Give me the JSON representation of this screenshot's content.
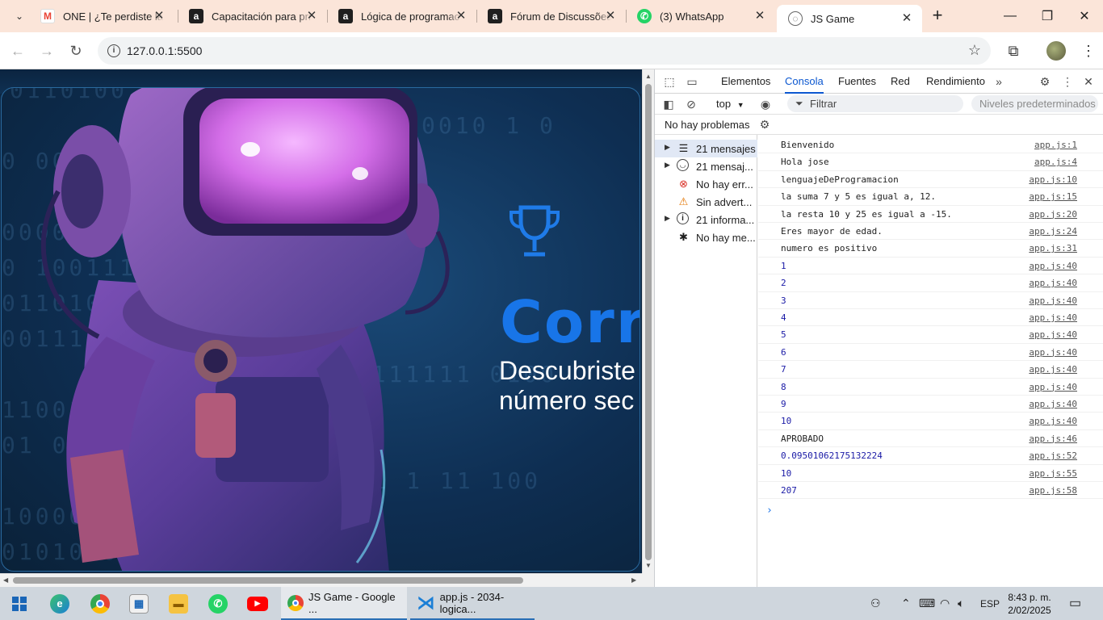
{
  "browser": {
    "tabs": [
      {
        "title": "ONE | ¿Te perdiste la",
        "icon": "gmail-icon"
      },
      {
        "title": "Capacitación para pri",
        "icon": "alura-icon"
      },
      {
        "title": "Lógica de programac",
        "icon": "alura-icon"
      },
      {
        "title": "Fórum de Discussões",
        "icon": "alura-icon"
      },
      {
        "title": "(3) WhatsApp",
        "icon": "whatsapp-icon"
      },
      {
        "title": "JS Game",
        "icon": "globe-icon",
        "active": true
      }
    ],
    "url": "127.0.0.1:5500"
  },
  "page": {
    "title_partial": "Corre",
    "subtitle_line1": "Descubriste",
    "subtitle_line2": "número sec",
    "binary_rows": [
      "0110100  1000000",
      "0010  1 0",
      "0  0001010  0 0",
      "0 0  00  0",
      "0000   0  0",
      "0 10011100",
      "01101010",
      "00111000",
      "1100  0100 111111 0100",
      "11001  0 0011010000011",
      "01  0101  01  01  1010",
      "10  010  00 01 1 11 100",
      "10000  0  0    0",
      "01010  011  11011"
    ]
  },
  "devtools": {
    "tabs": [
      "Elementos",
      "Consola",
      "Fuentes",
      "Red",
      "Rendimiento"
    ],
    "active_tab": "Consola",
    "context": "top",
    "filter_placeholder": "Filtrar",
    "levels": "Niveles predeterminados",
    "issues": "No hay problemas",
    "sidebar": [
      {
        "label": "21 mensajes",
        "icon": "list-icon",
        "expandable": true
      },
      {
        "label": "21 mensaj...",
        "icon": "user-icon",
        "expandable": true
      },
      {
        "label": "No hay err...",
        "icon": "error-icon",
        "expandable": false
      },
      {
        "label": "Sin advert...",
        "icon": "warning-icon",
        "expandable": false
      },
      {
        "label": "21 informa...",
        "icon": "info-icon",
        "expandable": true
      },
      {
        "label": "No hay me...",
        "icon": "bug-icon",
        "expandable": false
      }
    ],
    "logs": [
      {
        "msg": "Bienvenido",
        "src": "app.js:1"
      },
      {
        "msg": "Hola jose",
        "src": "app.js:4"
      },
      {
        "msg": "lenguajeDeProgramacion",
        "src": "app.js:10"
      },
      {
        "msg": "la suma 7 y 5 es igual a, 12.",
        "src": "app.js:15"
      },
      {
        "msg": "la resta 10 y 25 es igual a -15.",
        "src": "app.js:20"
      },
      {
        "msg": "Eres mayor de edad.",
        "src": "app.js:24"
      },
      {
        "msg": "numero es positivo",
        "src": "app.js:31"
      },
      {
        "msg": "1",
        "src": "app.js:40",
        "num": true
      },
      {
        "msg": "2",
        "src": "app.js:40",
        "num": true
      },
      {
        "msg": "3",
        "src": "app.js:40",
        "num": true
      },
      {
        "msg": "4",
        "src": "app.js:40",
        "num": true
      },
      {
        "msg": "5",
        "src": "app.js:40",
        "num": true
      },
      {
        "msg": "6",
        "src": "app.js:40",
        "num": true
      },
      {
        "msg": "7",
        "src": "app.js:40",
        "num": true
      },
      {
        "msg": "8",
        "src": "app.js:40",
        "num": true
      },
      {
        "msg": "9",
        "src": "app.js:40",
        "num": true
      },
      {
        "msg": "10",
        "src": "app.js:40",
        "num": true
      },
      {
        "msg": "APROBADO",
        "src": "app.js:46"
      },
      {
        "msg": "0.09501062175132224",
        "src": "app.js:52",
        "num": true
      },
      {
        "msg": "10",
        "src": "app.js:55",
        "num": true
      },
      {
        "msg": "207",
        "src": "app.js:58",
        "num": true
      }
    ],
    "prompt": "›"
  },
  "taskbar": {
    "apps": [
      {
        "label": "JS Game - Google ...",
        "icon": "chrome-icon"
      },
      {
        "label": "app.js - 2034-logica...",
        "icon": "vscode-icon"
      }
    ],
    "lang": "ESP",
    "time": "8:43 p. m.",
    "date": "2/02/2025"
  },
  "colors": {
    "accent": "#0b57d0",
    "hero_title": "#1875e8",
    "hero_bg": "#0e2e52",
    "tabstrip": "#fbe5d9"
  }
}
